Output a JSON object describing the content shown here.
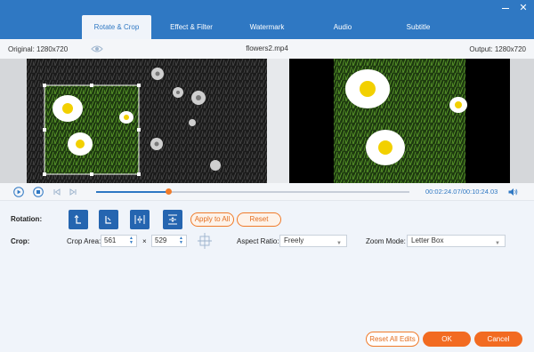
{
  "window": {
    "tabs": [
      {
        "label": "Rotate & Crop",
        "active": true
      },
      {
        "label": "Effect & Filter",
        "active": false
      },
      {
        "label": "Watermark",
        "active": false
      },
      {
        "label": "Audio",
        "active": false
      },
      {
        "label": "Subtitle",
        "active": false
      }
    ],
    "minimize": "—",
    "close": "✕"
  },
  "info": {
    "original": "Original: 1280x720",
    "filename": "flowers2.mp4",
    "output": "Output: 1280x720"
  },
  "playback": {
    "progress": 0.23,
    "time": "00:02:24.07/00:10:24.03"
  },
  "rotation": {
    "label": "Rotation:",
    "apply_all": "Apply to All",
    "reset": "Reset"
  },
  "crop": {
    "label": "Crop:",
    "area_label": "Crop Area:",
    "width": "561",
    "times": "×",
    "height": "529",
    "aspect_label": "Aspect Ratio:",
    "aspect_value": "Freely",
    "zoom_label": "Zoom Mode:",
    "zoom_value": "Letter Box"
  },
  "footer": {
    "reset_all": "Reset All Edits",
    "ok": "OK",
    "cancel": "Cancel"
  },
  "colors": {
    "accent": "#2f78c3",
    "orange": "#f26b21"
  }
}
